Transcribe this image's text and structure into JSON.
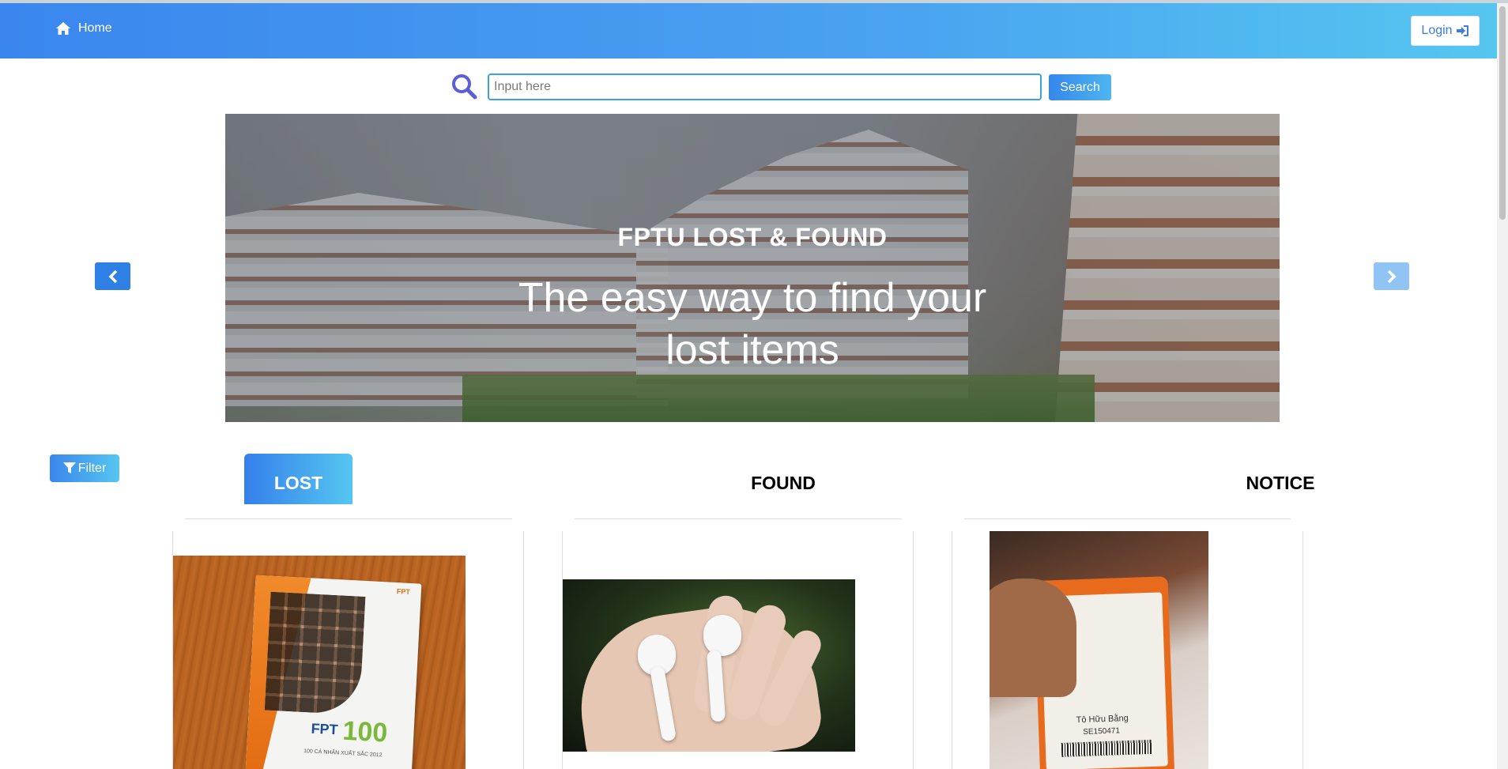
{
  "nav": {
    "home_label": "Home",
    "login_label": "Login",
    "home_icon": "home-icon",
    "login_icon": "sign-in-icon"
  },
  "search": {
    "placeholder": "Input here",
    "value": "",
    "button_label": "Search",
    "icon": "search-icon"
  },
  "carousel": {
    "title": "FPTU LOST & FOUND",
    "subtitle": "The easy way to find your lost items",
    "prev_icon": "chevron-left-icon",
    "next_icon": "chevron-right-icon"
  },
  "filter": {
    "label": "Filter",
    "icon": "filter-icon"
  },
  "tabs": [
    {
      "label": "LOST",
      "active": true
    },
    {
      "label": "FOUND",
      "active": false
    },
    {
      "label": "NOTICE",
      "active": false
    }
  ],
  "cards": {
    "lost": {
      "book_brand": "FPT",
      "book_number": "100",
      "book_caption": "100 CÁ NHÂN XUẤT SẮC 2012"
    },
    "found": {},
    "notice": {
      "id_name": "Tô Hữu Bằng",
      "id_code": "SE150471"
    }
  },
  "colors": {
    "nav_gradient_start": "#3a86ee",
    "nav_gradient_end": "#55c6f0",
    "accent": "#2f80e4"
  }
}
